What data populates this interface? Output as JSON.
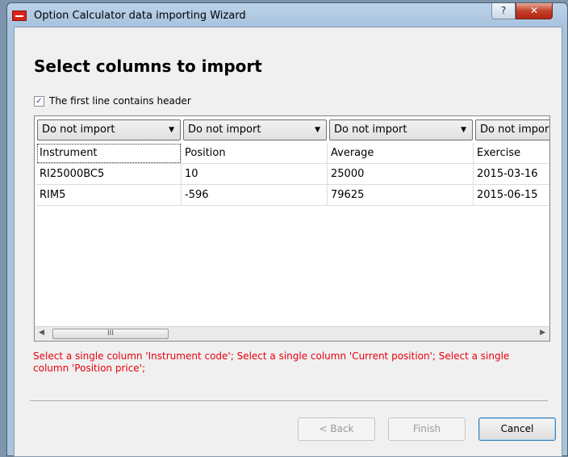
{
  "window": {
    "title": "Option Calculator data importing Wizard",
    "help_label": "?",
    "close_label": "✕"
  },
  "heading": "Select columns to import",
  "header_checkbox": {
    "label": "The first line contains header",
    "checked": true,
    "mark": "✓"
  },
  "grid": {
    "column_selectors": [
      "Do not import",
      "Do not import",
      "Do not import",
      "Do not import"
    ],
    "dropdown_arrow": "▼",
    "header_row": [
      "Instrument",
      "Position",
      "Average",
      "Exercise"
    ],
    "rows": [
      [
        "RI25000BC5",
        "10",
        "25000",
        "2015-03-16"
      ],
      [
        "RIM5",
        "-596",
        "79625",
        "2015-06-15"
      ]
    ],
    "scroll_left": "◀",
    "scroll_right": "▶",
    "thumb_grip": "III"
  },
  "error_message": "Select a single column  'Instrument code'; Select a single column  'Current position'; Select a single column  'Position price';",
  "buttons": {
    "back": "< Back",
    "finish": "Finish",
    "cancel": "Cancel"
  }
}
